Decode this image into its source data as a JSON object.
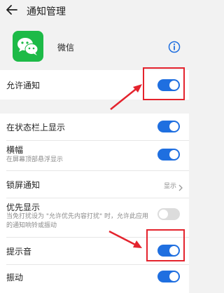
{
  "header": {
    "title": "通知管理"
  },
  "app": {
    "name": "微信"
  },
  "settings": {
    "allow_notifications": "允许通知",
    "status_bar": "在状态栏上显示",
    "banner": "横幅",
    "banner_desc": "在屏幕顶部悬浮显示",
    "lock_screen": "锁屏通知",
    "lock_screen_value": "显示",
    "priority": "优先显示",
    "priority_desc": "当免打扰设为 \"允许优先内容打扰\" 时，允许此应用的通知响铃或振动",
    "sound": "提示音",
    "vibrate": "振动"
  },
  "toggles": {
    "allow_notifications": true,
    "status_bar": true,
    "banner": true,
    "priority": false,
    "sound": true,
    "vibrate": true
  },
  "icons": {
    "back": "back-arrow-icon",
    "app": "wechat-icon",
    "info": "info-icon",
    "chevron": "chevron-right-icon"
  },
  "colors": {
    "accent": "#1f6fe0",
    "annotation": "#e4232d",
    "wechat_green": "#1dba47"
  }
}
